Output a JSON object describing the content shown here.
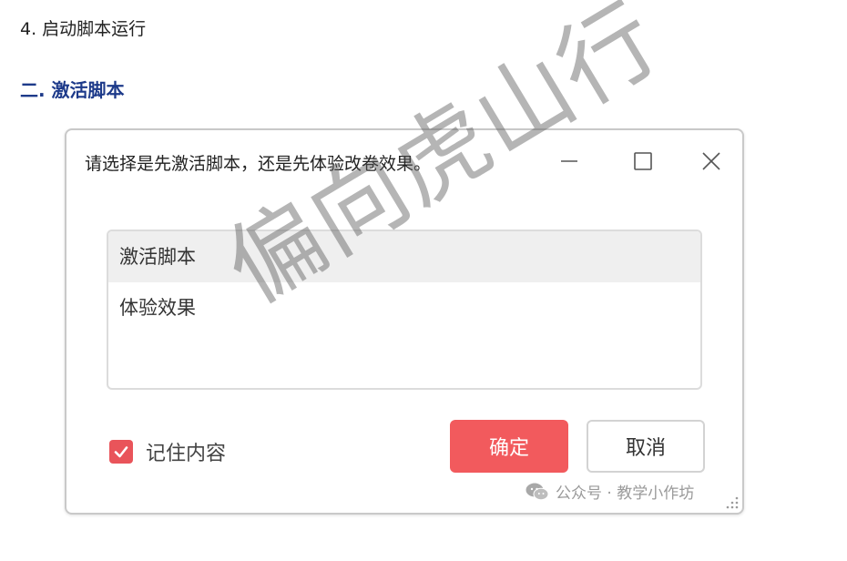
{
  "article": {
    "step_text": "4. 启动脚本运行",
    "section_heading": "二. 激活脚本"
  },
  "dialog": {
    "title": "请选择是先激活脚本，还是先体验改卷效果。",
    "options": [
      {
        "label": "激活脚本",
        "selected": true
      },
      {
        "label": "体验效果",
        "selected": false
      }
    ],
    "remember_label": "记住内容",
    "remember_checked": true,
    "ok_label": "确定",
    "cancel_label": "取消",
    "colors": {
      "accent": "#f25a5d",
      "checkbox": "#e9545a",
      "heading": "#1d3a8a"
    }
  },
  "watermark": {
    "overlay_text": "偏向虎山行",
    "source_label": "公众号 · 教学小作坊",
    "source_icon": "wechat-icon"
  }
}
